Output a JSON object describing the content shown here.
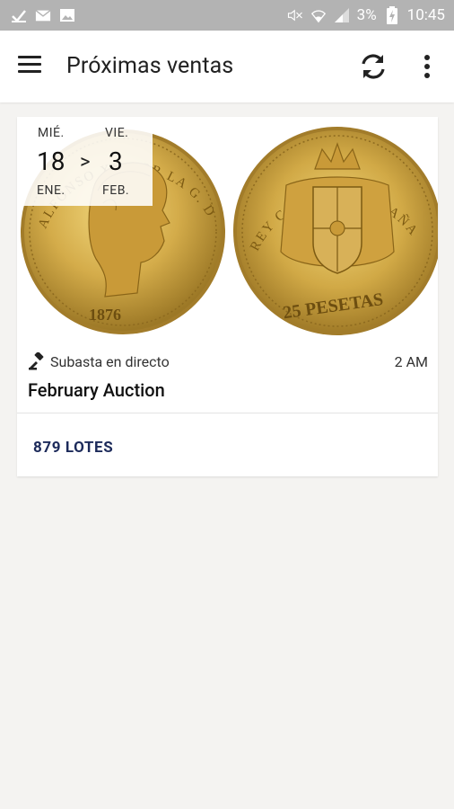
{
  "status_bar": {
    "battery": "3%",
    "time": "10:45",
    "icons": [
      "check-icon",
      "mail-icon",
      "image-icon",
      "mute-icon",
      "wifi-icon",
      "signal-icon",
      "battery-charging-icon"
    ]
  },
  "app_bar": {
    "title": "Próximas ventas",
    "icons": [
      "menu-icon",
      "refresh-icon",
      "more-vert-icon"
    ]
  },
  "sale": {
    "start_weekday": "MIÉ.",
    "start_day": "18",
    "start_month": "ENE.",
    "separator": ">",
    "end_weekday": "VIE.",
    "end_day": "3",
    "end_month": "FEB.",
    "type_label": "Subasta en directo",
    "time": "2 AM",
    "title": "February Auction",
    "lots_label": "879 LOTES",
    "obverse_year": "1876",
    "obverse_legend": "ALFONSO XII POR LA G. DE DIOS",
    "reverse_legend": "REY CONST. DE ESPAÑA",
    "reverse_value": "25 PESETAS"
  },
  "colors": {
    "status_bar": "#b3b3b3",
    "background": "#f4f3f1",
    "lots_text": "#1c2a5a",
    "gold": "#c9a23f"
  }
}
